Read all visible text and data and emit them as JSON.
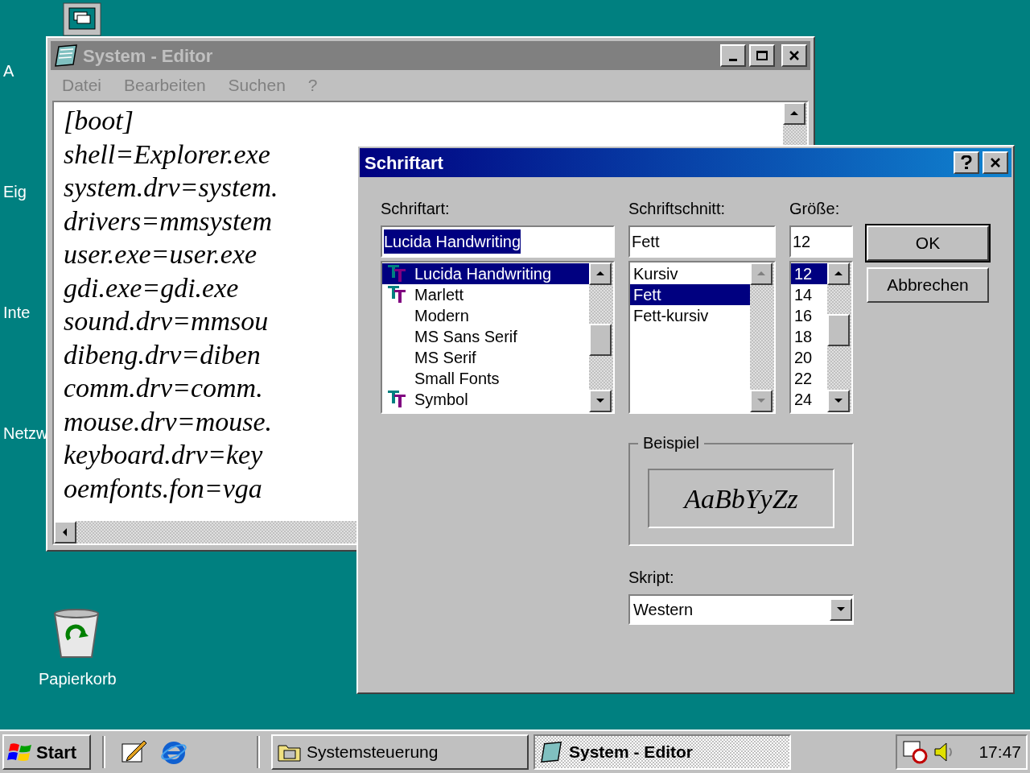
{
  "desktop": {
    "icons": [
      {
        "label": "A"
      },
      {
        "label": "Eig"
      },
      {
        "label": "Inte"
      },
      {
        "label": "Netzw"
      },
      {
        "label": "Papierkorb"
      }
    ]
  },
  "editor": {
    "title": "System - Editor",
    "active": false,
    "menu": [
      "Datei",
      "Bearbeiten",
      "Suchen",
      "?"
    ],
    "lines": [
      "[boot]",
      "shell=Explorer.exe",
      "system.drv=system.",
      "drivers=mmsystem",
      "user.exe=user.exe",
      "gdi.exe=gdi.exe",
      "sound.drv=mmsou",
      "dibeng.drv=diben",
      "comm.drv=comm.",
      "mouse.drv=mouse.",
      "keyboard.drv=key",
      "oemfonts.fon=vga"
    ]
  },
  "dialog": {
    "title": "Schriftart",
    "active": true,
    "font": {
      "label": "Schriftart:",
      "value": "Lucida Handwriting",
      "value_highlighted": true,
      "items": [
        {
          "name": "Lucida Handwriting",
          "truetype": true,
          "selected": true
        },
        {
          "name": "Marlett",
          "truetype": true,
          "selected": false
        },
        {
          "name": "Modern",
          "truetype": false,
          "selected": false
        },
        {
          "name": "MS Sans Serif",
          "truetype": false,
          "selected": false
        },
        {
          "name": "MS Serif",
          "truetype": false,
          "selected": false
        },
        {
          "name": "Small Fonts",
          "truetype": false,
          "selected": false
        },
        {
          "name": "Symbol",
          "truetype": true,
          "selected": false
        }
      ]
    },
    "style": {
      "label": "Schriftschnitt:",
      "value": "Fett",
      "scroll_disabled": true,
      "items": [
        {
          "name": "Kursiv",
          "selected": false
        },
        {
          "name": "Fett",
          "selected": true
        },
        {
          "name": "Fett-kursiv",
          "selected": false
        }
      ]
    },
    "size": {
      "label": "Größe:",
      "value": "12",
      "items": [
        {
          "name": "12",
          "selected": true
        },
        {
          "name": "14",
          "selected": false
        },
        {
          "name": "16",
          "selected": false
        },
        {
          "name": "18",
          "selected": false
        },
        {
          "name": "20",
          "selected": false
        },
        {
          "name": "22",
          "selected": false
        },
        {
          "name": "24",
          "selected": false
        }
      ]
    },
    "buttons": [
      {
        "label": "OK",
        "default": true
      },
      {
        "label": "Abbrechen",
        "default": false
      }
    ],
    "sample": {
      "label": "Beispiel",
      "text": "AaBbYyZz"
    },
    "script": {
      "label": "Skript:",
      "value": "Western"
    }
  },
  "taskbar": {
    "start": "Start",
    "tasks": [
      {
        "label": "Systemsteuerung",
        "selected": false
      },
      {
        "label": "System - Editor",
        "selected": true
      }
    ],
    "clock": "17:47"
  }
}
